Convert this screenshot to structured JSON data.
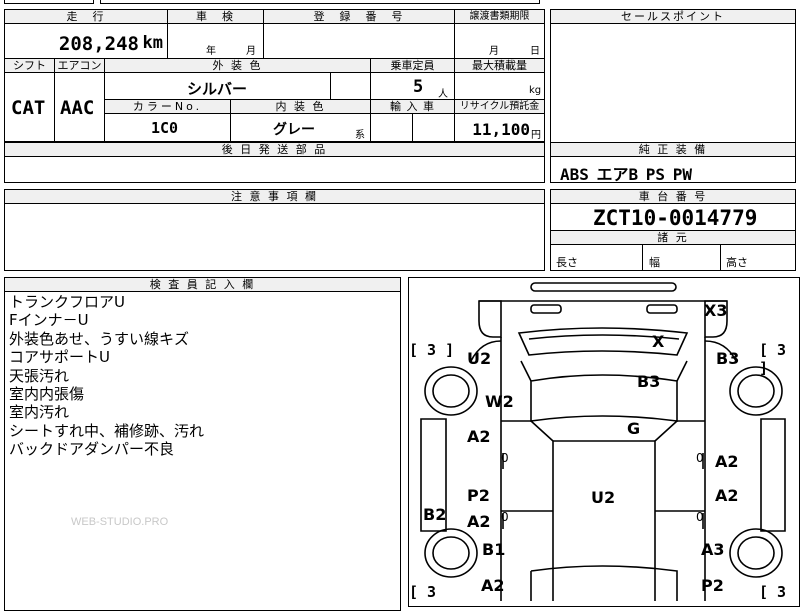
{
  "header": {
    "mileage_label": "走　行",
    "inspection_label": "車　検",
    "registration_label": "登　録　番　号",
    "transfer_deadline_label": "譲渡書類期限",
    "sales_point_label": "セールスポイント"
  },
  "values": {
    "mileage": "208,248",
    "mileage_unit": "km",
    "insp_year": "年",
    "insp_month": "月",
    "transfer_month": "月",
    "transfer_day": "日"
  },
  "row2": {
    "shift_label": "シフト",
    "aircon_label": "エアコン",
    "ext_color_label": "外 装 色",
    "capacity_label": "乗車定員",
    "max_load_label": "最大積載量",
    "shift": "CAT",
    "aircon": "AAC",
    "ext_color": "シルバー",
    "capacity": "5",
    "capacity_unit": "人",
    "max_load_unit": "kg",
    "color_no_label": "カラーNo.",
    "interior_label": "内 装 色",
    "import_label": "輸 入 車",
    "recycle_label": "リサイクル預託金",
    "color_no": "1C0",
    "interior": "グレー",
    "interior_suffix": "系",
    "recycle": "11,100",
    "recycle_unit": "円"
  },
  "parts": {
    "later_parts_label": "後 日 発 送 部 品",
    "std_equip_label": "純 正 装 備",
    "std_equip": "ABS エアB PS PW"
  },
  "notes": {
    "caution_label": "注 意 事 項 欄",
    "chassis_label": "車 台 番 号",
    "chassis_no": "ZCT10-0014779",
    "dims_label": "諸 元",
    "length_label": "長さ",
    "width_label": "幅",
    "height_label": "高さ"
  },
  "inspector": {
    "label": "検 査 員 記 入 欄",
    "lines": [
      "トランクフロアU",
      "Fインナ－U",
      "外装色あせ、うすい線キズ",
      "コアサポートU",
      "天張汚れ",
      "室内内張傷",
      "室内汚れ",
      "シートすれ中、補修跡、汚れ",
      "バックドアダンパー不良"
    ],
    "watermark": "WEB-STUDIO.PRO"
  },
  "damage_marks": {
    "x3": "X3",
    "x": "X",
    "u2_left": "U2",
    "b3_right": "B3",
    "b3_center": "B3",
    "w2": "W2",
    "g": "G",
    "a2_left_top": "A2",
    "a2_right_top": "A2",
    "p2_left": "P2",
    "u2_center": "U2",
    "a2_right_mid": "A2",
    "b2": "B2",
    "a2_left_mid": "A2",
    "b1": "B1",
    "a3": "A3",
    "a2_left_bottom": "A2",
    "p2_right": "P2",
    "bracket_3a": "[ 3 ]",
    "bracket_3b": "[ 3 ]",
    "bracket_3c": "[ 3",
    "bracket_3d": "[ 3",
    "zero_1": "0",
    "zero_2": "0",
    "zero_3": "0",
    "zero_4": "0"
  }
}
